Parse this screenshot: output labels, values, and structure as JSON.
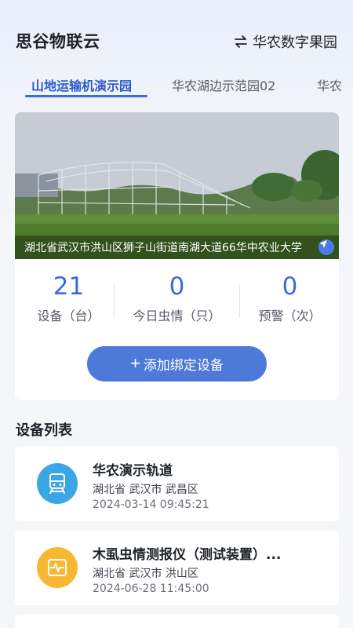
{
  "header": {
    "app_title": "思谷物联云",
    "farm_switch_label": "华农数字果园",
    "switch_icon": "swap-arrows-icon"
  },
  "tabs": [
    {
      "label": "山地运输机演示园",
      "active": true
    },
    {
      "label": "华农湖边示范园02",
      "active": false
    },
    {
      "label": "华农",
      "active": false
    }
  ],
  "farm_card": {
    "address": "湖北省武汉市洪山区狮子山街道南湖大道66华中农业大学",
    "locate_icon": "navigation-arrow-icon",
    "stats": [
      {
        "value": "21",
        "label": "设备（台）"
      },
      {
        "value": "0",
        "label": "今日虫情（只）"
      },
      {
        "value": "0",
        "label": "预警（次）"
      }
    ],
    "add_button_label": "添加绑定设备"
  },
  "device_list": {
    "title": "设备列表",
    "items": [
      {
        "name": "华农演示轨道",
        "region": "湖北省 武汉市 武昌区",
        "time": "2024-03-14 09:45:21",
        "icon": "rail-train-icon",
        "icon_color": "#3aa6e6"
      },
      {
        "name": "木虱虫情测报仪（测试装置）...",
        "region": "湖北省 武汉市 洪山区",
        "time": "2024-06-28 11:45:00",
        "icon": "pulse-monitor-icon",
        "icon_color": "#f7b733"
      }
    ]
  },
  "colors": {
    "accent": "#3b6bd9",
    "button": "#4d79d8"
  }
}
